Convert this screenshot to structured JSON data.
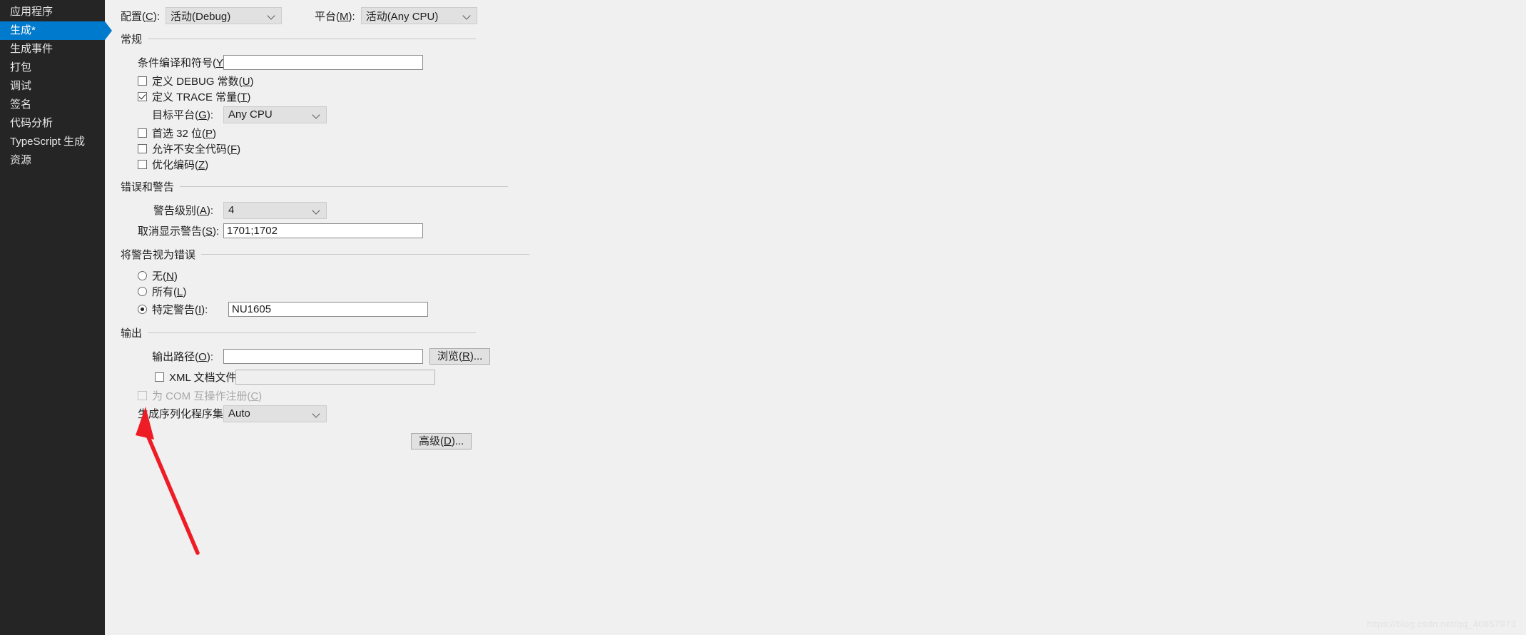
{
  "sidebar": {
    "items": [
      {
        "label": "应用程序",
        "selected": false
      },
      {
        "label": "生成*",
        "selected": true
      },
      {
        "label": "生成事件",
        "selected": false
      },
      {
        "label": "打包",
        "selected": false
      },
      {
        "label": "调试",
        "selected": false
      },
      {
        "label": "签名",
        "selected": false
      },
      {
        "label": "代码分析",
        "selected": false
      },
      {
        "label": "TypeScript 生成",
        "selected": false
      },
      {
        "label": "资源",
        "selected": false
      }
    ],
    "accent_color": "#007acc",
    "background_color": "#252526"
  },
  "topbar": {
    "configuration_label": "配置(C):",
    "configuration_value": "活动(Debug)",
    "platform_label": "平台(M):",
    "platform_value": "活动(Any CPU)"
  },
  "general": {
    "title": "常规",
    "conditional_symbols_label": "条件编译和符号(Y):",
    "conditional_symbols_value": "",
    "define_debug_label": "定义 DEBUG 常数(U)",
    "define_debug_checked": false,
    "define_trace_label": "定义 TRACE 常量(T)",
    "define_trace_checked": true,
    "target_platform_label": "目标平台(G):",
    "target_platform_value": "Any CPU",
    "prefer32_label": "首选 32 位(P)",
    "prefer32_checked": false,
    "allow_unsafe_label": "允许不安全代码(F)",
    "allow_unsafe_checked": false,
    "optimize_label": "优化编码(Z)",
    "optimize_checked": false
  },
  "errors_warnings": {
    "title": "错误和警告",
    "warning_level_label": "警告级别(A):",
    "warning_level_value": "4",
    "suppress_warnings_label": "取消显示警告(S):",
    "suppress_warnings_value": "1701;1702"
  },
  "warnings_as_errors": {
    "title": "将警告视为错误",
    "none_label": "无(N)",
    "none_selected": false,
    "all_label": "所有(L)",
    "all_selected": false,
    "specific_label": "特定警告(I):",
    "specific_selected": true,
    "specific_value": "NU1605"
  },
  "output": {
    "title": "输出",
    "output_path_label": "输出路径(O):",
    "output_path_value": "",
    "browse_button": "浏览(R)...",
    "xml_doc_label": "XML 文档文件(X):",
    "xml_doc_checked": false,
    "xml_doc_value": "",
    "xml_doc_enabled": false,
    "com_interop_label": "为 COM 互操作注册(C)",
    "com_interop_checked": false,
    "com_interop_enabled": false,
    "serialization_label": "生成序列化程序集(E):",
    "serialization_value": "Auto",
    "advanced_button": "高级(D)..."
  },
  "annotation": {
    "arrow_color": "#ee1c25"
  },
  "watermark": {
    "text": "https://blog.csdn.net/qq_40857973"
  }
}
